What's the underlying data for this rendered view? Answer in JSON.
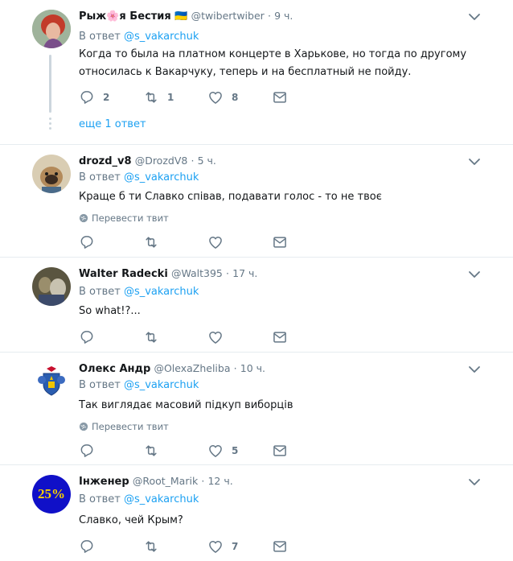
{
  "common": {
    "reply_prefix": "В ответ",
    "reply_mention": "@s_vakarchuk",
    "dot": "·",
    "translate_label": "Перевести твит"
  },
  "tweets": [
    {
      "name": "Рыж🌸я Бестия 🇺🇦",
      "handle": "@twibertwiber",
      "time": "9 ч.",
      "text": "Когда то была на платном концерте в Харькове, но тогда по другому относилась к Вакарчуку,  теперь и на бесплатный не пойду.",
      "replies": "2",
      "retweets": "1",
      "likes": "8",
      "more_replies": "еще 1 ответ"
    },
    {
      "name": "drozd_v8",
      "handle": "@DrozdV8",
      "time": "5 ч.",
      "text": "Краще б ти Славко співав, подавати голос - то не твоє",
      "replies": "",
      "retweets": "",
      "likes": ""
    },
    {
      "name": "Walter Radecki",
      "handle": "@Walt395",
      "time": "17 ч.",
      "text": "So what!?...",
      "replies": "",
      "retweets": "",
      "likes": ""
    },
    {
      "name": "Олекс Андр",
      "handle": "@OlexaZheliba",
      "time": "10 ч.",
      "text": "Так виглядає масовий  підкуп виборців",
      "replies": "",
      "retweets": "",
      "likes": "5"
    },
    {
      "name": "Інженер",
      "handle": "@Root_Marik",
      "time": "12 ч.",
      "text": "Славко, чей Крым?",
      "replies": "",
      "retweets": "",
      "likes": "7",
      "avatar_text": "25%"
    }
  ],
  "colors": {
    "accent": "#1da1f2",
    "muted": "#657786",
    "border": "#e6ecf0",
    "avatar5_bg": "#1010c8",
    "avatar5_text": "#f5d000"
  }
}
